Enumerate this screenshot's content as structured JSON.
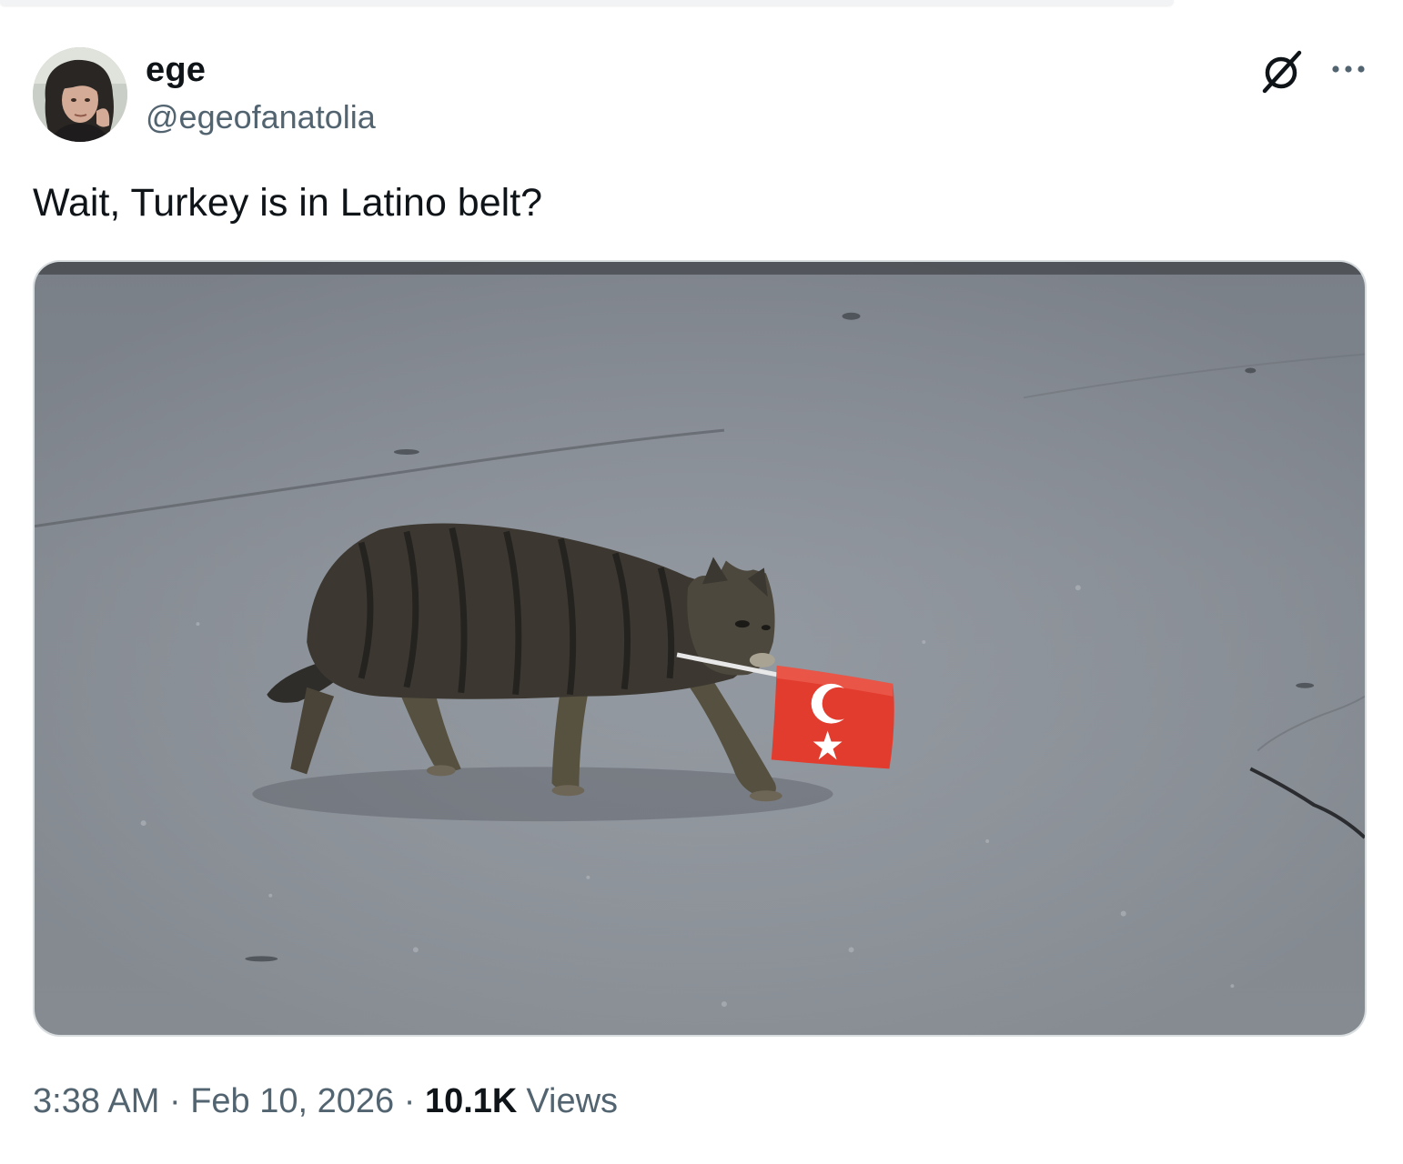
{
  "tweet": {
    "author": {
      "display_name": "ege",
      "handle": "@egeofanatolia"
    },
    "text": "Wait, Turkey is in Latino belt?",
    "media": {
      "alt": "Tabby cat walking on asphalt carrying a small Turkish flag in its mouth"
    },
    "meta": {
      "time": "3:38 AM",
      "separator": "·",
      "date": "Feb 10, 2026",
      "views_count": "10.1K",
      "views_label": "Views"
    },
    "icons": {
      "grok": "grok-icon",
      "more": "more-dots-icon"
    }
  },
  "colors": {
    "text_primary": "#0f1419",
    "text_secondary": "#536471",
    "flag_red": "#e30a17"
  }
}
